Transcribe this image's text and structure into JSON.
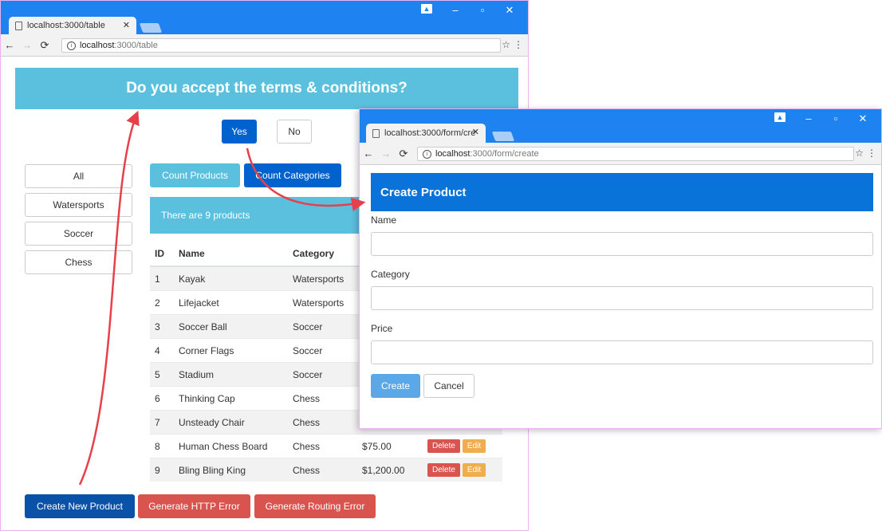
{
  "main_window": {
    "tab_title": "localhost:3000/table",
    "url_host": "localhost",
    "url_path": ":3000/table",
    "banner": "Do you accept the terms & conditions?",
    "yes_label": "Yes",
    "no_label": "No",
    "categories": [
      "All",
      "Watersports",
      "Soccer",
      "Chess"
    ],
    "count_products_label": "Count Products",
    "count_categories_label": "Count Categories",
    "info_text": "There are 9 products",
    "table": {
      "headers": [
        "ID",
        "Name",
        "Category"
      ],
      "rows": [
        {
          "id": "1",
          "name": "Kayak",
          "category": "Watersports",
          "price": "",
          "actions": false
        },
        {
          "id": "2",
          "name": "Lifejacket",
          "category": "Watersports",
          "price": "",
          "actions": false
        },
        {
          "id": "3",
          "name": "Soccer Ball",
          "category": "Soccer",
          "price": "",
          "actions": false
        },
        {
          "id": "4",
          "name": "Corner Flags",
          "category": "Soccer",
          "price": "",
          "actions": false
        },
        {
          "id": "5",
          "name": "Stadium",
          "category": "Soccer",
          "price": "",
          "actions": false
        },
        {
          "id": "6",
          "name": "Thinking Cap",
          "category": "Chess",
          "price": "",
          "actions": false
        },
        {
          "id": "7",
          "name": "Unsteady Chair",
          "category": "Chess",
          "price": "",
          "actions": false
        },
        {
          "id": "8",
          "name": "Human Chess Board",
          "category": "Chess",
          "price": "$75.00",
          "actions": true
        },
        {
          "id": "9",
          "name": "Bling Bling King",
          "category": "Chess",
          "price": "$1,200.00",
          "actions": true
        }
      ],
      "delete_label": "Delete",
      "edit_label": "Edit"
    },
    "create_new_label": "Create New Product",
    "http_error_label": "Generate HTTP Error",
    "routing_error_label": "Generate Routing Error"
  },
  "form_window": {
    "tab_title": "localhost:3000/form/cre",
    "url_host": "localhost",
    "url_path": ":3000/form/create",
    "header": "Create Product",
    "fields": [
      {
        "label": "Name",
        "value": ""
      },
      {
        "label": "Category",
        "value": ""
      },
      {
        "label": "Price",
        "value": ""
      }
    ],
    "create_label": "Create",
    "cancel_label": "Cancel"
  },
  "colors": {
    "chrome_blue": "#1e82f0",
    "info": "#5bc0de",
    "primary": "#0062cc",
    "danger": "#d9534f",
    "warning": "#f0ad4e",
    "arrow": "#e8404a"
  },
  "icons": [
    "page-icon",
    "close-icon",
    "back-icon",
    "forward-icon",
    "reload-icon",
    "info-icon",
    "star-icon",
    "menu-icon",
    "user-icon",
    "minimize-icon",
    "maximize-icon"
  ]
}
